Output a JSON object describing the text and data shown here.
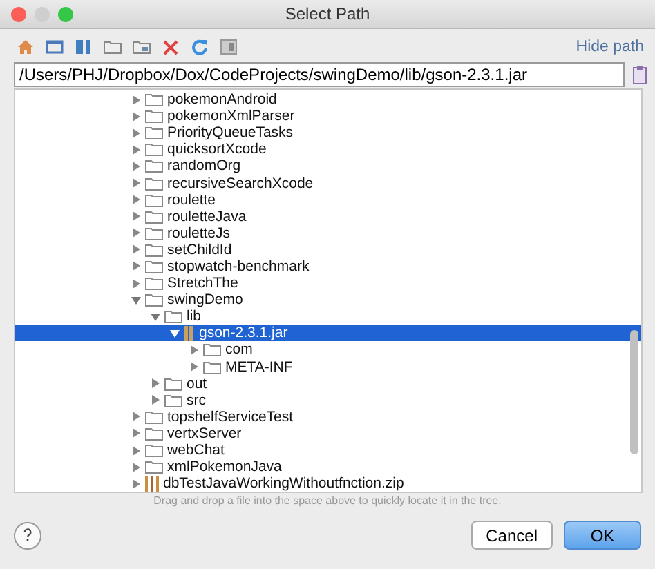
{
  "window": {
    "title": "Select Path"
  },
  "toolbar": {
    "hide_path_link": "Hide path"
  },
  "path_field": {
    "value": "/Users/PHJ/Dropbox/Dox/CodeProjects/swingDemo/lib/gson-2.3.1.jar"
  },
  "tree": [
    {
      "label": "pokemonAndroid",
      "kind": "folder",
      "expanded": false,
      "selected": false
    },
    {
      "label": "pokemonXmlParser",
      "kind": "folder",
      "expanded": false,
      "selected": false
    },
    {
      "label": "PriorityQueueTasks",
      "kind": "folder",
      "expanded": false,
      "selected": false
    },
    {
      "label": "quicksortXcode",
      "kind": "folder",
      "expanded": false,
      "selected": false
    },
    {
      "label": "randomOrg",
      "kind": "folder",
      "expanded": false,
      "selected": false
    },
    {
      "label": "recursiveSearchXcode",
      "kind": "folder",
      "expanded": false,
      "selected": false
    },
    {
      "label": "roulette",
      "kind": "folder",
      "expanded": false,
      "selected": false
    },
    {
      "label": "rouletteJava",
      "kind": "folder",
      "expanded": false,
      "selected": false
    },
    {
      "label": "rouletteJs",
      "kind": "folder",
      "expanded": false,
      "selected": false
    },
    {
      "label": "setChildId",
      "kind": "folder",
      "expanded": false,
      "selected": false
    },
    {
      "label": "stopwatch-benchmark",
      "kind": "folder",
      "expanded": false,
      "selected": false
    },
    {
      "label": "StretchThe",
      "kind": "folder",
      "expanded": false,
      "selected": false
    },
    {
      "label": "swingDemo",
      "kind": "folder",
      "expanded": true,
      "selected": false,
      "children": [
        {
          "label": "lib",
          "kind": "folder",
          "expanded": true,
          "selected": false,
          "children": [
            {
              "label": "gson-2.3.1.jar",
              "kind": "jar",
              "expanded": true,
              "selected": true,
              "children": [
                {
                  "label": "com",
                  "kind": "folder",
                  "expanded": false,
                  "selected": false
                },
                {
                  "label": "META-INF",
                  "kind": "folder",
                  "expanded": false,
                  "selected": false
                }
              ]
            }
          ]
        },
        {
          "label": "out",
          "kind": "folder",
          "expanded": false,
          "selected": false
        },
        {
          "label": "src",
          "kind": "folder",
          "expanded": false,
          "selected": false
        }
      ]
    },
    {
      "label": "topshelfServiceTest",
      "kind": "folder",
      "expanded": false,
      "selected": false
    },
    {
      "label": "vertxServer",
      "kind": "folder",
      "expanded": false,
      "selected": false
    },
    {
      "label": "webChat",
      "kind": "folder",
      "expanded": false,
      "selected": false
    },
    {
      "label": "xmlPokemonJava",
      "kind": "folder",
      "expanded": false,
      "selected": false
    },
    {
      "label": "dbTestJavaWorkingWithoutfnction.zip",
      "kind": "zip",
      "expanded": false,
      "selected": false
    }
  ],
  "hint": "Drag and drop a file into the space above to quickly locate it in the tree.",
  "buttons": [
    {
      "label": "Cancel",
      "kind": "normal"
    },
    {
      "label": "OK",
      "kind": "default"
    }
  ]
}
